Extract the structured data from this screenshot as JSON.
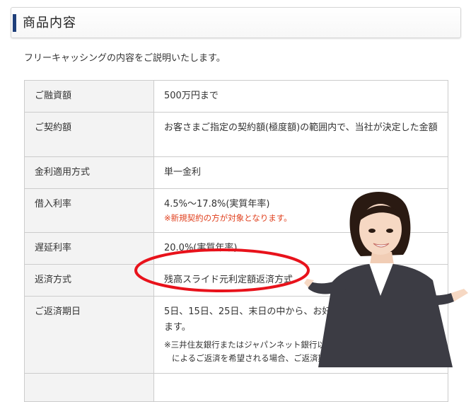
{
  "header": {
    "title": "商品内容"
  },
  "intro": "フリーキャッシングの内容をご説明いたします。",
  "table": {
    "rows": [
      {
        "label": "ご融資額",
        "value": "500万円まで"
      },
      {
        "label": "ご契約額",
        "value": "お客さまご指定の契約額(極度額)の範囲内で、当社が決定した金額"
      },
      {
        "label": "金利適用方式",
        "value": "単一金利"
      },
      {
        "label": "借入利率",
        "value": "4.5%～17.8%(実質年率)",
        "note": "※新規契約の方が対象となります。"
      },
      {
        "label": "遅延利率",
        "value": "20.0%(実質年率)"
      },
      {
        "label": "返済方式",
        "value": "残高スライド元利定額返済方式"
      },
      {
        "label": "ご返済期日",
        "value": "5日、15日、25日、末日の中から、お好きな日をお選びいただけます。",
        "note_line1": "※三井住友銀行またはジャパンネット銀行以外の金融機関口座",
        "note_line2": "によるご返済を希望される場合、ご返済期日は5日となります。"
      },
      {
        "label": "",
        "value": ""
      }
    ]
  },
  "colors": {
    "accent": "#1f3f7a",
    "note_red": "#e0401e",
    "ring": "#e8121b"
  }
}
